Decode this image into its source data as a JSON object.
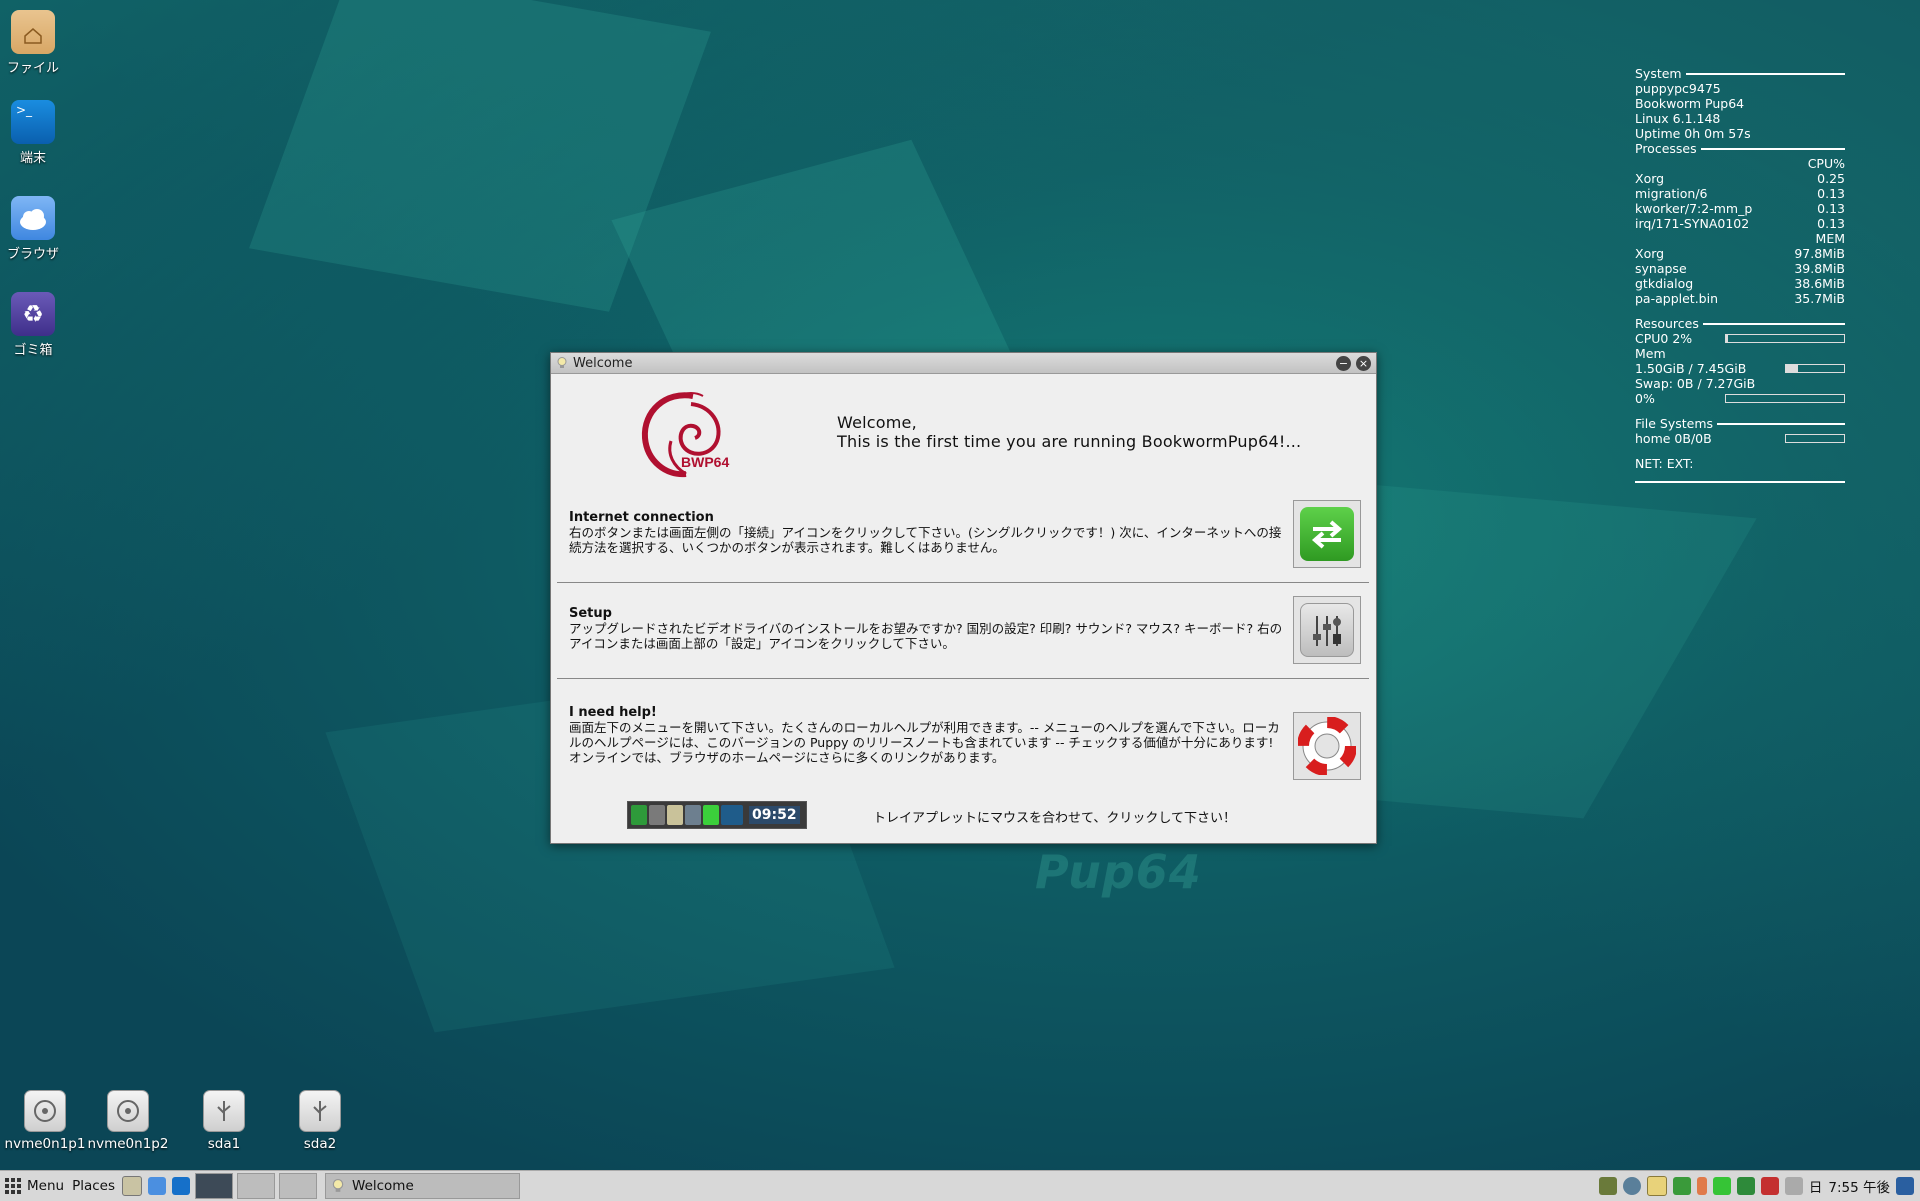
{
  "desktop": {
    "icons": [
      {
        "label": "ファイル"
      },
      {
        "label": "端末"
      },
      {
        "label": "ブラウザ"
      },
      {
        "label": "ゴミ箱"
      }
    ],
    "watermark": "Pup64",
    "drives": [
      {
        "label": "nvme0n1p1"
      },
      {
        "label": "nvme0n1p2"
      },
      {
        "label": "sda1"
      },
      {
        "label": "sda2"
      }
    ]
  },
  "conky": {
    "system_header": "System",
    "hostname": "puppypc9475",
    "distro": "Bookworm Pup64",
    "kernel": "Linux 6.1.148",
    "uptime": "Uptime 0h 0m 57s",
    "processes_header": "Processes",
    "cpu_col": "CPU%",
    "cpu_procs": [
      {
        "name": "Xorg",
        "value": "0.25"
      },
      {
        "name": "migration/6",
        "value": "0.13"
      },
      {
        "name": "kworker/7:2-mm_p",
        "value": "0.13"
      },
      {
        "name": "irq/171-SYNA0102",
        "value": "0.13"
      }
    ],
    "mem_col": "MEM",
    "mem_procs": [
      {
        "name": "Xorg",
        "value": "97.8MiB"
      },
      {
        "name": "synapse",
        "value": "39.8MiB"
      },
      {
        "name": "gtkdialog",
        "value": "38.6MiB"
      },
      {
        "name": "pa-applet.bin",
        "value": "35.7MiB"
      }
    ],
    "resources_header": "Resources",
    "cpu0": "CPU0 2%",
    "cpu0_fraction": 0.02,
    "mem_label": "Mem",
    "mem_value": "1.50GiB / 7.45GiB",
    "mem_fraction": 0.2,
    "swap_label": "Swap: 0B / 7.27GiB",
    "swap_pct": "0%",
    "swap_fraction": 0,
    "fs_header": "File Systems",
    "fs_home": "home 0B/0B",
    "net": "NET: EXT:"
  },
  "welcome": {
    "title": "Welcome",
    "logo_text": "BWP64",
    "greeting_line1": "Welcome,",
    "greeting_line2": "This is the first time you are running BookwormPup64!...",
    "sections": [
      {
        "title": "Internet connection",
        "body": "右のボタンまたは画面左側の「接続」アイコンをクリックして下さい。(シングルクリックです！) 次に、インターネットへの接続方法を選択する、いくつかのボタンが表示されます。難しくはありません。",
        "icon": "network-connect-icon"
      },
      {
        "title": "Setup",
        "body": "アップグレードされたビデオドライバのインストールをお望みですか? 国別の設定? 印刷? サウンド? マウス? キーボード? 右のアイコンまたは画面上部の「設定」アイコンをクリックして下さい。",
        "icon": "settings-sliders-icon"
      },
      {
        "title": "I need help!",
        "body": "画面左下のメニューを開いて下さい。たくさんのローカルヘルプが利用できます。-- メニューのヘルプを選んで下さい。ローカルのヘルプページには、このバージョンの Puppy のリリースノートも含まれています -- チェックする価値が十分にあります! オンラインでは、ブラウザのホームページにさらに多くのリンクがあります。",
        "icon": "lifebuoy-icon"
      }
    ],
    "tray_clock": "09:52",
    "tray_hint": "トレイアプレットにマウスを合わせて、クリックして下さい！"
  },
  "taskbar": {
    "menu": "Menu",
    "places": "Places",
    "task_title": "Welcome",
    "day": "日",
    "clock": "7:55 午後"
  }
}
